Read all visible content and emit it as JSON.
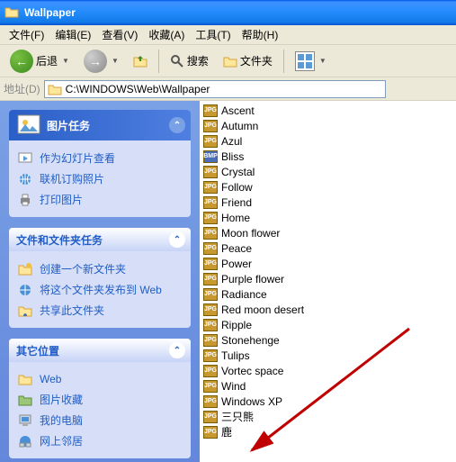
{
  "window": {
    "title": "Wallpaper"
  },
  "menu": {
    "file": "文件(F)",
    "edit": "编辑(E)",
    "view": "查看(V)",
    "favorites": "收藏(A)",
    "tools": "工具(T)",
    "help": "帮助(H)"
  },
  "toolbar": {
    "back": "后退",
    "search": "搜索",
    "folders": "文件夹"
  },
  "address": {
    "label": "地址(D)",
    "path": "C:\\WINDOWS\\Web\\Wallpaper"
  },
  "panels": {
    "pictasks": {
      "title": "图片任务",
      "items": [
        "作为幻灯片查看",
        "联机订购照片",
        "打印图片"
      ]
    },
    "foldertasks": {
      "title": "文件和文件夹任务",
      "items": [
        "创建一个新文件夹",
        "将这个文件夹发布到 Web",
        "共享此文件夹"
      ]
    },
    "other": {
      "title": "其它位置",
      "items": [
        "Web",
        "图片收藏",
        "我的电脑",
        "网上邻居"
      ]
    }
  },
  "files": [
    {
      "name": "Ascent",
      "type": "jpg"
    },
    {
      "name": "Autumn",
      "type": "jpg"
    },
    {
      "name": "Azul",
      "type": "jpg"
    },
    {
      "name": "Bliss",
      "type": "bmp"
    },
    {
      "name": "Crystal",
      "type": "jpg"
    },
    {
      "name": "Follow",
      "type": "jpg"
    },
    {
      "name": "Friend",
      "type": "jpg"
    },
    {
      "name": "Home",
      "type": "jpg"
    },
    {
      "name": "Moon flower",
      "type": "jpg"
    },
    {
      "name": "Peace",
      "type": "jpg"
    },
    {
      "name": "Power",
      "type": "jpg"
    },
    {
      "name": "Purple flower",
      "type": "jpg"
    },
    {
      "name": "Radiance",
      "type": "jpg"
    },
    {
      "name": "Red moon desert",
      "type": "jpg"
    },
    {
      "name": "Ripple",
      "type": "jpg"
    },
    {
      "name": "Stonehenge",
      "type": "jpg"
    },
    {
      "name": "Tulips",
      "type": "jpg"
    },
    {
      "name": "Vortec space",
      "type": "jpg"
    },
    {
      "name": "Wind",
      "type": "jpg"
    },
    {
      "name": "Windows XP",
      "type": "jpg"
    },
    {
      "name": "三只熊",
      "type": "jpg"
    },
    {
      "name": "鹿",
      "type": "jpg"
    }
  ]
}
